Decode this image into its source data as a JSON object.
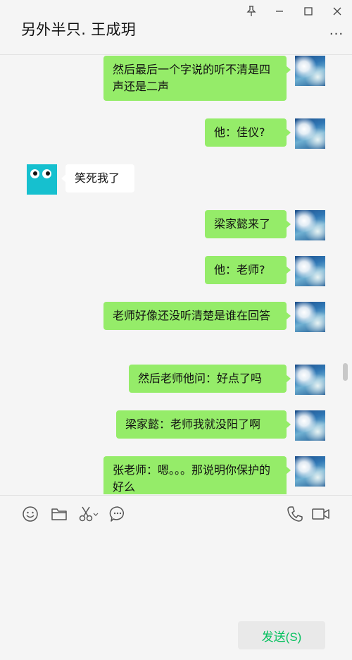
{
  "window": {
    "title": "另外半只. 王成玥",
    "pin_icon": "pin-icon",
    "minimize_icon": "minimize-icon",
    "maximize_icon": "maximize-icon",
    "close_icon": "close-icon",
    "more_label": "···"
  },
  "messages": [
    {
      "side": "right",
      "text": "然后最后一个字说的听不清是四声还是二声"
    },
    {
      "side": "right",
      "text": "他：佳仪?"
    },
    {
      "side": "left",
      "text": "笑死我了"
    },
    {
      "side": "right",
      "text": "梁家懿来了"
    },
    {
      "side": "right",
      "text": "他：老师?"
    },
    {
      "side": "right",
      "text": "老师好像还没听清楚是谁在回答"
    },
    {
      "side": "right",
      "text": "然后老师他问：好点了吗"
    },
    {
      "side": "right",
      "text": "梁家懿：老师我就没阳了啊"
    },
    {
      "side": "right",
      "text": "张老师：嗯。。。那说明你保护的好么"
    }
  ],
  "toolbar": {
    "icons": [
      "emoji-icon",
      "folder-icon",
      "scissors-icon",
      "chat-history-icon",
      "phone-icon",
      "video-icon"
    ]
  },
  "input": {
    "value": "",
    "send_label": "发送(S)"
  },
  "colors": {
    "my_bubble": "#95ec69",
    "their_bubble": "#ffffff",
    "send_text": "#07c160",
    "background": "#f5f5f5"
  }
}
